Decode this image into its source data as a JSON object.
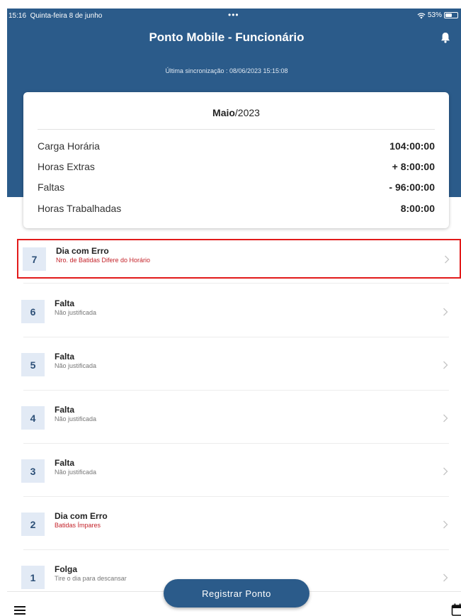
{
  "statusbar": {
    "time": "15:16",
    "date": "Quinta-feira 8 de junho",
    "dots": "•••",
    "battery": "53%"
  },
  "header": {
    "title": "Ponto Mobile - Funcionário",
    "sync": "Última sincronização : 08/06/2023 15:15:08"
  },
  "summary": {
    "month": "Maio",
    "year": "/2023",
    "rows": [
      {
        "label": "Carga Horária",
        "value": "104:00:00"
      },
      {
        "label": "Horas Extras",
        "value": "+ 8:00:00"
      },
      {
        "label": "Faltas",
        "value": "- 96:00:00"
      },
      {
        "label": "Horas Trabalhadas",
        "value": "8:00:00"
      }
    ]
  },
  "days": [
    {
      "day": "7",
      "title": "Dia com Erro",
      "subtitle": "Nro. de Batidas Difere do Horário",
      "error": true
    },
    {
      "day": "6",
      "title": "Falta",
      "subtitle": "Não justificada",
      "error": false
    },
    {
      "day": "5",
      "title": "Falta",
      "subtitle": "Não justificada",
      "error": false
    },
    {
      "day": "4",
      "title": "Falta",
      "subtitle": "Não justificada",
      "error": false
    },
    {
      "day": "3",
      "title": "Falta",
      "subtitle": "Não justificada",
      "error": false
    },
    {
      "day": "2",
      "title": "Dia com Erro",
      "subtitle": "Batidas Ímpares",
      "error": true
    },
    {
      "day": "1",
      "title": "Folga",
      "subtitle": "Tire o dia para descansar",
      "error": false
    }
  ],
  "actions": {
    "register": "Registrar Ponto"
  },
  "icons": {
    "menu": "menu-icon",
    "calendar": "calendar-icon",
    "bell": "bell-icon"
  },
  "colors": {
    "primary": "#2b5b8a",
    "error": "#c4232a",
    "badge_bg": "#e2eaf5",
    "highlight": "#e21a1a"
  }
}
